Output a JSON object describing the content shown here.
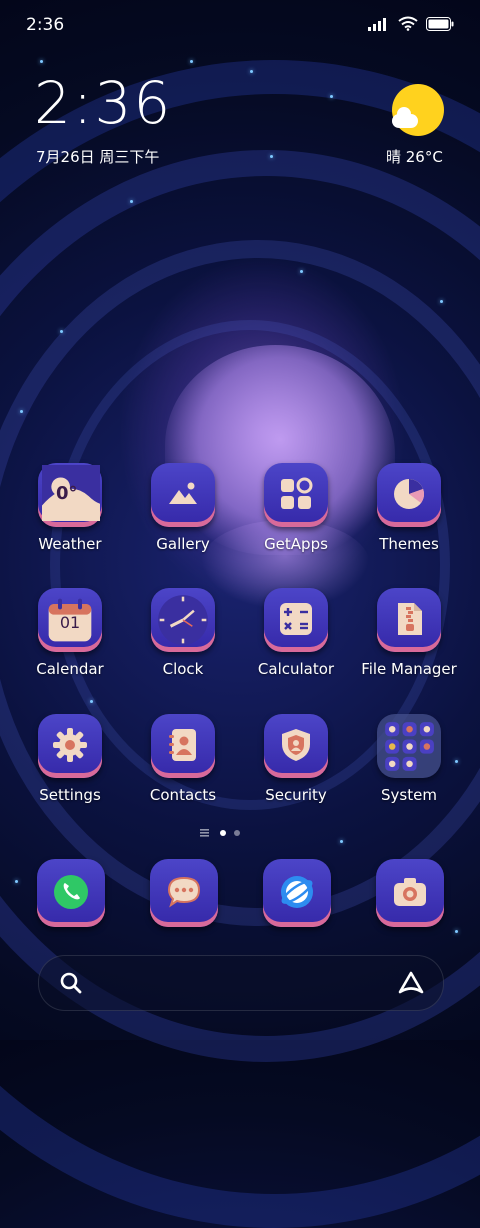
{
  "status_bar": {
    "time": "2:36"
  },
  "clock_widget": {
    "time": "2:36",
    "date": "7月26日 周三下午"
  },
  "weather_widget": {
    "text": "晴 26°C",
    "icon": "sunny-cloud-icon"
  },
  "apps": [
    {
      "label": "Weather",
      "icon": "weather-icon"
    },
    {
      "label": "Gallery",
      "icon": "gallery-icon"
    },
    {
      "label": "GetApps",
      "icon": "getapps-icon"
    },
    {
      "label": "Themes",
      "icon": "themes-icon"
    },
    {
      "label": "Calendar",
      "icon": "calendar-icon",
      "day": "01"
    },
    {
      "label": "Clock",
      "icon": "clock-icon"
    },
    {
      "label": "Calculator",
      "icon": "calculator-icon"
    },
    {
      "label": "File Manager",
      "icon": "file-manager-icon"
    },
    {
      "label": "Settings",
      "icon": "settings-icon"
    },
    {
      "label": "Contacts",
      "icon": "contacts-icon"
    },
    {
      "label": "Security",
      "icon": "security-icon"
    },
    {
      "label": "System",
      "icon": "system-folder-icon"
    }
  ],
  "weather_app_temp": "0°",
  "dock": [
    {
      "icon": "phone-icon"
    },
    {
      "icon": "messages-icon"
    },
    {
      "icon": "browser-icon"
    },
    {
      "icon": "camera-icon"
    }
  ],
  "pager": {
    "current": 2,
    "total": 3
  },
  "search": {
    "left_icon": "search-icon",
    "right_icon": "assistant-icon"
  }
}
